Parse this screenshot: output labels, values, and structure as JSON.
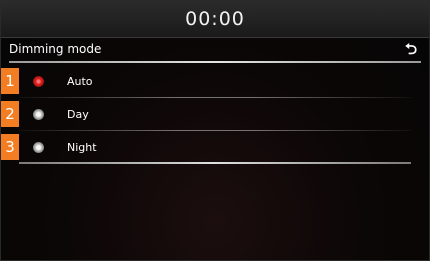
{
  "status": {
    "clock": "00:00"
  },
  "header": {
    "title": "Dimming mode",
    "back_icon": "return-arrow-icon"
  },
  "options": [
    {
      "index": "1",
      "label": "Auto",
      "selected": true
    },
    {
      "index": "2",
      "label": "Day",
      "selected": false
    },
    {
      "index": "3",
      "label": "Night",
      "selected": false
    }
  ],
  "colors": {
    "badge": "#f27d22",
    "selected_radio": "#e02020",
    "background": "#050505"
  }
}
